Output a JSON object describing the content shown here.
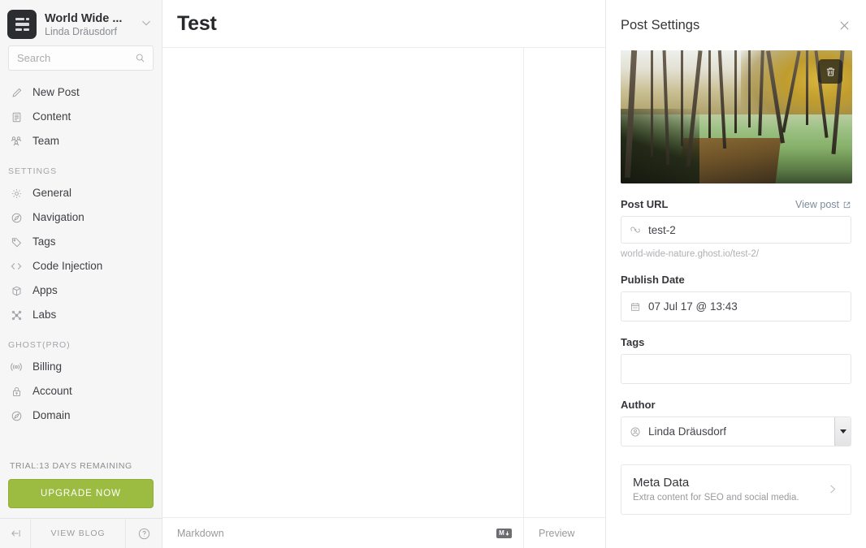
{
  "sidebar": {
    "blog": {
      "name": "World Wide ...",
      "user": "Linda Dräusdorf"
    },
    "search": {
      "placeholder": "Search",
      "value": ""
    },
    "nav": [
      {
        "label": "New Post",
        "icon": "pencil-icon"
      },
      {
        "label": "Content",
        "icon": "document-icon"
      },
      {
        "label": "Team",
        "icon": "people-icon"
      }
    ],
    "settings_section": "SETTINGS",
    "settings_items": [
      {
        "label": "General",
        "icon": "gear-icon"
      },
      {
        "label": "Navigation",
        "icon": "compass-icon"
      },
      {
        "label": "Tags",
        "icon": "tag-icon"
      },
      {
        "label": "Code Injection",
        "icon": "code-icon"
      },
      {
        "label": "Apps",
        "icon": "box-icon"
      },
      {
        "label": "Labs",
        "icon": "flask-icon"
      }
    ],
    "pro_section": "GHOST(PRO)",
    "pro_items": [
      {
        "label": "Billing",
        "icon": "broadcast-icon"
      },
      {
        "label": "Account",
        "icon": "lock-icon"
      },
      {
        "label": "Domain",
        "icon": "compass-icon"
      }
    ],
    "trial_text": "TRIAL:13 DAYS REMAINING",
    "upgrade_label": "UPGRADE NOW",
    "footer": {
      "view_blog": "VIEW BLOG",
      "collapse_icon": "collapse-arrow-icon",
      "help_icon": "help-icon"
    }
  },
  "editor": {
    "title": "Test",
    "markdown_label": "Markdown",
    "markdown_badge": "M",
    "preview_label": "Preview"
  },
  "settings_panel": {
    "title": "Post Settings",
    "close_icon": "close-icon",
    "featured_image": {
      "delete_icon": "trash-icon",
      "alt": "autumn forest swamp with green algae water"
    },
    "post_url": {
      "label": "Post URL",
      "view_post": "View post",
      "view_post_icon": "external-link-icon",
      "icon": "link-icon",
      "value": "test-2",
      "full_url": "world-wide-nature.ghost.io/test-2/"
    },
    "publish_date": {
      "label": "Publish Date",
      "icon": "calendar-icon",
      "value": "07 Jul 17 @ 13:43"
    },
    "tags": {
      "label": "Tags",
      "value": "",
      "placeholder": ""
    },
    "author": {
      "label": "Author",
      "icon": "user-circle-icon",
      "value": "Linda Dräusdorf"
    },
    "meta_data": {
      "title": "Meta Data",
      "subtitle": "Extra content for SEO and social media.",
      "chevron_icon": "chevron-right-icon"
    }
  },
  "colors": {
    "accent_green": "#9bbc41",
    "sidebar_bg": "#f6f6f7",
    "link_blue": "#7d8a99"
  }
}
